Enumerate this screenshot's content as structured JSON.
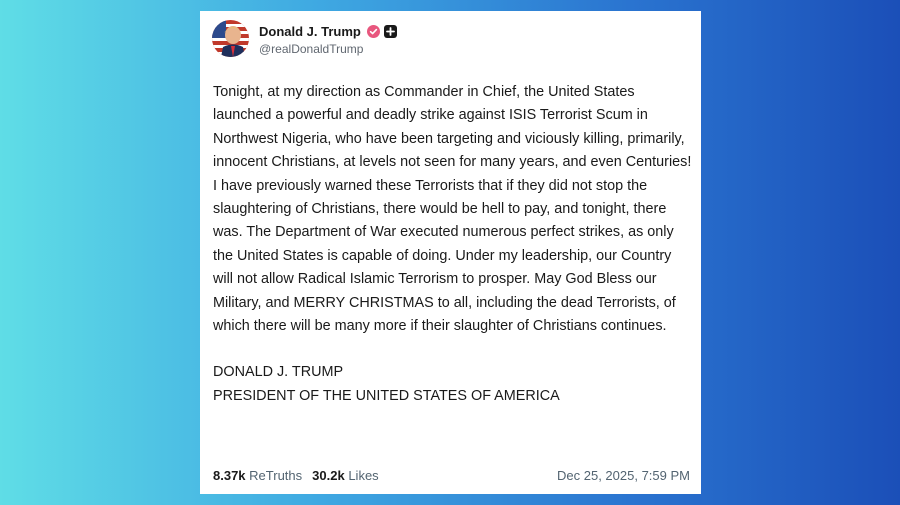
{
  "post": {
    "author": {
      "display_name": "Donald J. Trump",
      "handle": "@realDonaldTrump",
      "verified_icon": "verified-badge-icon",
      "extra_icon": "plus-square-icon"
    },
    "text": "Tonight, at my direction as Commander in Chief, the United States launched a powerful and deadly strike against ISIS Terrorist Scum in Northwest Nigeria, who have been targeting and viciously killing, primarily, innocent Christians, at levels not seen for many years, and even Centuries! I have previously warned these Terrorists that if they did not stop the slaughtering of Christians, there would be hell to pay, and tonight, there was. The Department of War executed numerous perfect strikes, as only the United States is capable of doing. Under my leadership, our Country will not allow Radical Islamic Terrorism to prosper. May God Bless our Military, and MERRY CHRISTMAS to all, including the dead Terrorists, of which there will be many more if their slaughter of Christians continues.",
    "signature_line1": "DONALD J. TRUMP",
    "signature_line2": "PRESIDENT OF THE UNITED STATES OF AMERICA",
    "stats": {
      "retruths_count": "8.37k",
      "retruths_label": "ReTruths",
      "likes_count": "30.2k",
      "likes_label": "Likes"
    },
    "timestamp": "Dec 25, 2025, 7:59 PM"
  },
  "colors": {
    "verified_badge": "#e8577e",
    "background_left": "#5fdde6",
    "background_right": "#1b4fb8"
  }
}
